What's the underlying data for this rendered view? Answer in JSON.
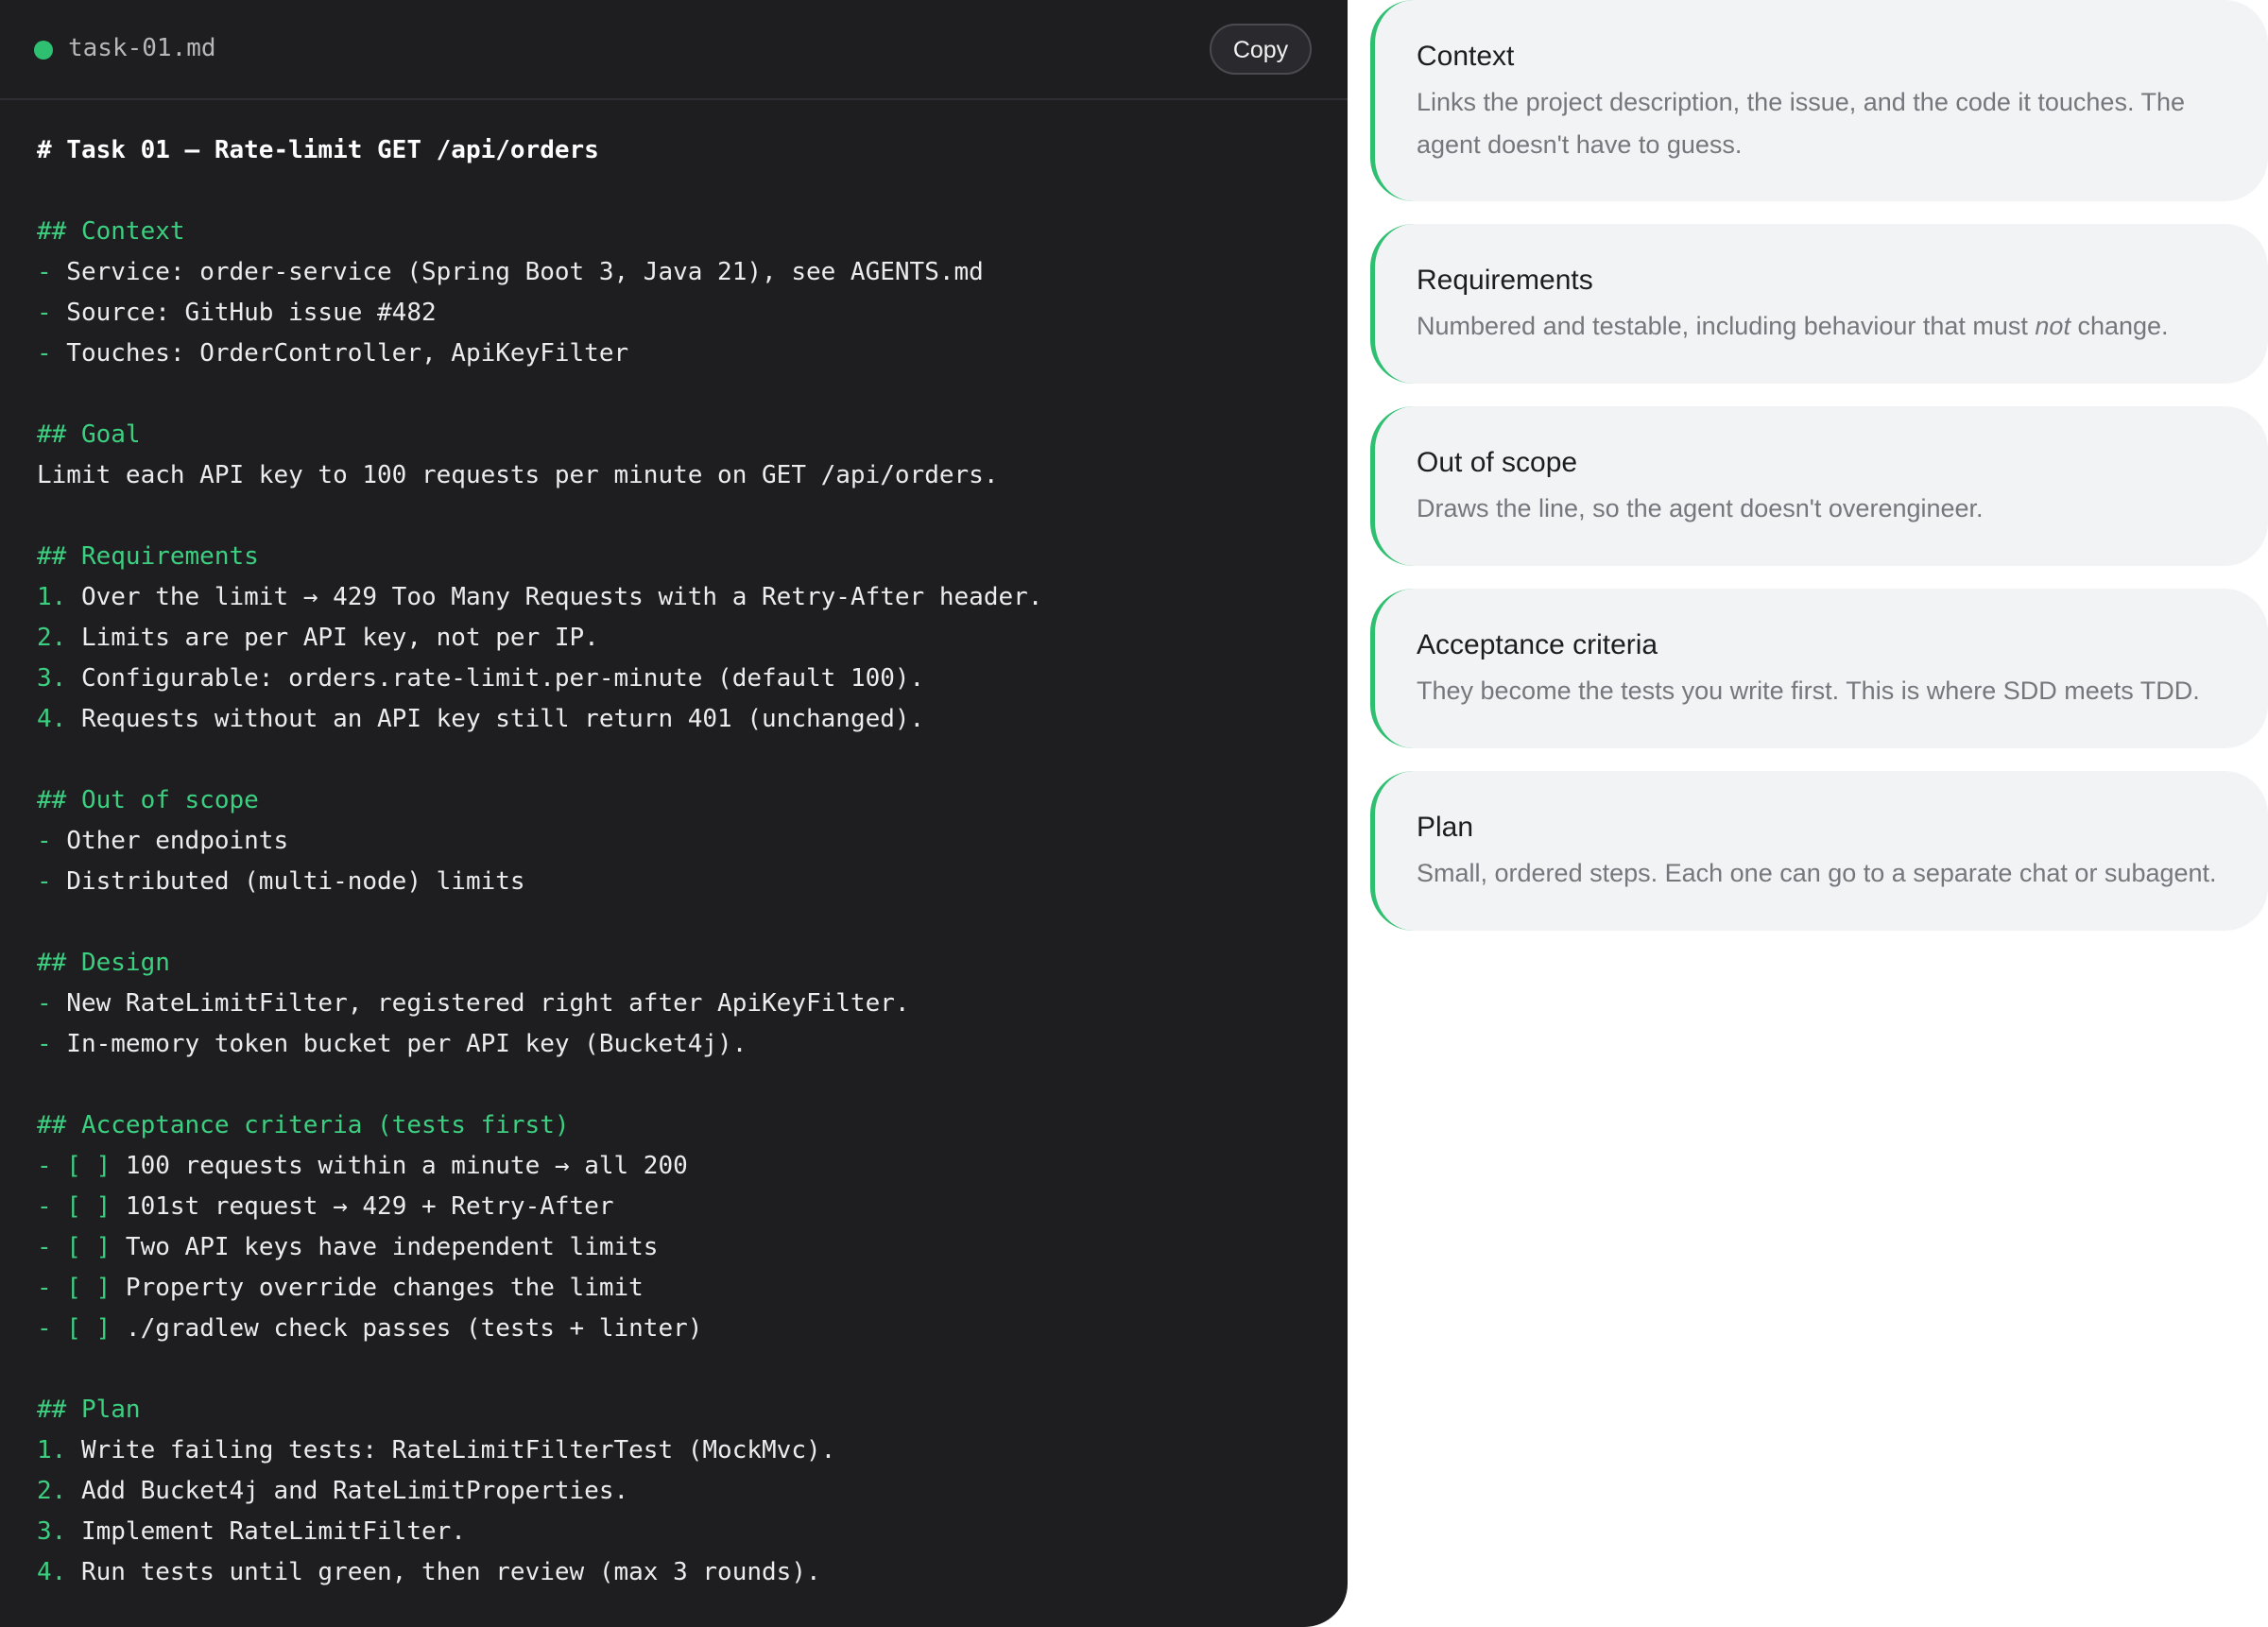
{
  "editor": {
    "filename": "task-01.md",
    "copy_label": "Copy",
    "status_color": "#2fbf71",
    "lines": [
      {
        "kind": "h1",
        "text": "# Task 01 — Rate-limit GET /api/orders"
      },
      {
        "kind": "blank"
      },
      {
        "kind": "h2",
        "text": "## Context"
      },
      {
        "kind": "item",
        "marker": "-",
        "text": " Service: order-service (Spring Boot 3, Java 21), see AGENTS.md"
      },
      {
        "kind": "item",
        "marker": "-",
        "text": " Source: GitHub issue #482"
      },
      {
        "kind": "item",
        "marker": "-",
        "text": " Touches: OrderController, ApiKeyFilter"
      },
      {
        "kind": "blank"
      },
      {
        "kind": "h2",
        "text": "## Goal"
      },
      {
        "kind": "text",
        "text": "Limit each API key to 100 requests per minute on GET /api/orders."
      },
      {
        "kind": "blank"
      },
      {
        "kind": "h2",
        "text": "## Requirements"
      },
      {
        "kind": "item",
        "marker": "1.",
        "text": " Over the limit → 429 Too Many Requests with a Retry-After header."
      },
      {
        "kind": "item",
        "marker": "2.",
        "text": " Limits are per API key, not per IP."
      },
      {
        "kind": "item",
        "marker": "3.",
        "text": " Configurable: orders.rate-limit.per-minute (default 100)."
      },
      {
        "kind": "item",
        "marker": "4.",
        "text": " Requests without an API key still return 401 (unchanged)."
      },
      {
        "kind": "blank"
      },
      {
        "kind": "h2",
        "text": "## Out of scope"
      },
      {
        "kind": "item",
        "marker": "-",
        "text": " Other endpoints"
      },
      {
        "kind": "item",
        "marker": "-",
        "text": " Distributed (multi-node) limits"
      },
      {
        "kind": "blank"
      },
      {
        "kind": "h2",
        "text": "## Design"
      },
      {
        "kind": "item",
        "marker": "-",
        "text": " New RateLimitFilter, registered right after ApiKeyFilter."
      },
      {
        "kind": "item",
        "marker": "-",
        "text": " In-memory token bucket per API key (Bucket4j)."
      },
      {
        "kind": "blank"
      },
      {
        "kind": "h2",
        "text": "## Acceptance criteria (tests first)"
      },
      {
        "kind": "item",
        "marker": "- [ ]",
        "text": " 100 requests within a minute → all 200"
      },
      {
        "kind": "item",
        "marker": "- [ ]",
        "text": " 101st request → 429 + Retry-After"
      },
      {
        "kind": "item",
        "marker": "- [ ]",
        "text": " Two API keys have independent limits"
      },
      {
        "kind": "item",
        "marker": "- [ ]",
        "text": " Property override changes the limit"
      },
      {
        "kind": "item",
        "marker": "- [ ]",
        "text": " ./gradlew check passes (tests + linter)"
      },
      {
        "kind": "blank"
      },
      {
        "kind": "h2",
        "text": "## Plan"
      },
      {
        "kind": "item",
        "marker": "1.",
        "text": " Write failing tests: RateLimitFilterTest (MockMvc)."
      },
      {
        "kind": "item",
        "marker": "2.",
        "text": " Add Bucket4j and RateLimitProperties."
      },
      {
        "kind": "item",
        "marker": "3.",
        "text": " Implement RateLimitFilter."
      },
      {
        "kind": "item",
        "marker": "4.",
        "text": " Run tests until green, then review (max 3 rounds)."
      }
    ]
  },
  "cards": [
    {
      "title": "Context",
      "text": "Links the project description, the issue, and the code it touches. The agent doesn't have to guess."
    },
    {
      "title": "Requirements",
      "text_before": "Numbered and testable, including behaviour that must ",
      "text_em": "not",
      "text_after": " change."
    },
    {
      "title": "Out of scope",
      "text": "Draws the line, so the agent doesn't overengineer."
    },
    {
      "title": "Acceptance criteria",
      "text": "They become the tests you write first. This is where SDD meets TDD."
    },
    {
      "title": "Plan",
      "text": "Small, ordered steps. Each one can go to a separate chat or subagent."
    }
  ]
}
